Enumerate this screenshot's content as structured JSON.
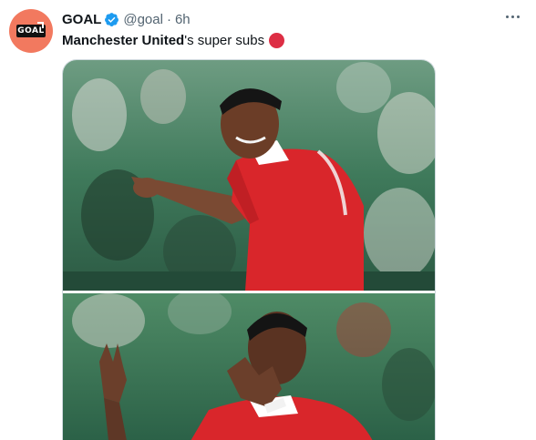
{
  "tweet": {
    "author_name": "GOAL",
    "handle": "@goal",
    "separator": "·",
    "time": "6h",
    "avatar_text": "GOAL",
    "text_mention": "Manchester United",
    "text_rest": "'s super subs",
    "emoji": "red-circle"
  },
  "colors": {
    "avatar_bg": "#f2795f",
    "verified": "#1d9bf0",
    "kit_red": "#d9262b",
    "crowd_green": "#3e8a5e"
  },
  "icons": [
    "verified-badge-icon",
    "more-options-icon",
    "red-circle-emoji-icon"
  ]
}
